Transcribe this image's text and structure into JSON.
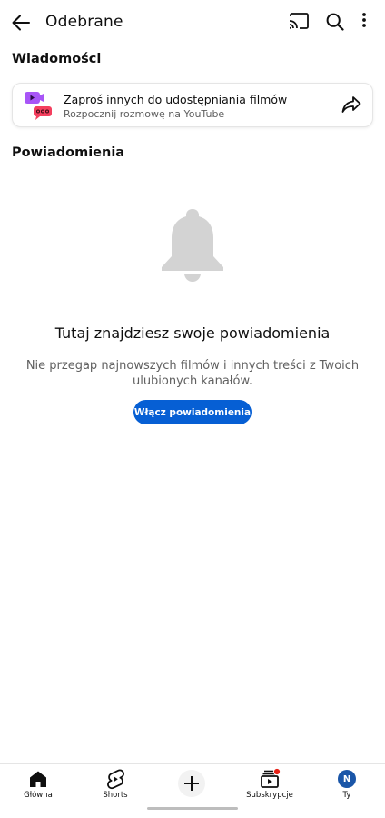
{
  "header": {
    "title": "Odebrane",
    "back_icon": "arrow-left-icon",
    "cast_icon": "cast-icon",
    "search_icon": "search-icon",
    "more_icon": "more-vert-icon"
  },
  "messages_section": {
    "heading": "Wiadomości",
    "invite_card": {
      "title": "Zaproś innych do udostępniania filmów",
      "subtitle": "Rozpocznij rozmowę na YouTube",
      "icon": "video-chat-icon",
      "action_icon": "share-icon"
    }
  },
  "notifications_section": {
    "heading": "Powiadomienia",
    "empty_icon": "bell-icon",
    "empty_title": "Tutaj znajdziesz swoje powiadomienia",
    "empty_description": "Nie przegap najnowszych filmów i innych treści z Twoich ulubionych kanałów.",
    "enable_button": "Włącz powiadomienia"
  },
  "bottom_nav": {
    "items": [
      {
        "label": "Główna",
        "icon": "home-icon"
      },
      {
        "label": "Shorts",
        "icon": "shorts-icon"
      },
      {
        "label": "",
        "icon": "plus-icon"
      },
      {
        "label": "Subskrypcje",
        "icon": "subscriptions-icon"
      },
      {
        "label": "Ty",
        "icon": "avatar",
        "avatar_letter": "N"
      }
    ]
  },
  "colors": {
    "accent": "#065fd4",
    "notification_dot": "#e62117",
    "avatar_bg": "#1a56a8"
  }
}
